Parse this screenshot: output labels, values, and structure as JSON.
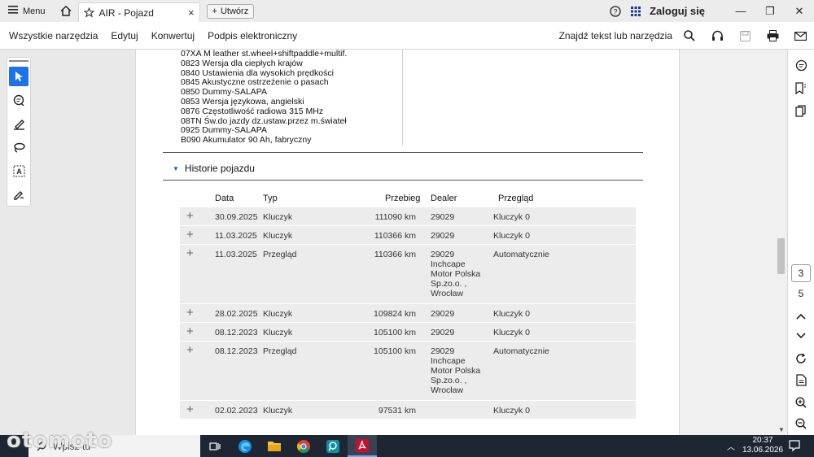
{
  "tabbar": {
    "menu_label": "Menu",
    "tab_title": "AIR - Pojazd",
    "tab_close": "×",
    "create_label": "Utwórz",
    "login_label": "Zaloguj się",
    "minimize": "—",
    "maximize": "❐",
    "close": "✕"
  },
  "menubar": {
    "items": [
      "Wszystkie narzędzia",
      "Edytuj",
      "Konwertuj",
      "Podpis elektroniczny"
    ],
    "find_label": "Znajdź tekst lub narzędzia"
  },
  "document": {
    "options": [
      "07XA M leather st.wheel+shiftpaddle+multif.",
      "0823 Wersja dla ciepłych krajów",
      "0840 Ustawienia dla wysokich prędkości",
      "0845 Akustyczne ostrzeżenie o pasach",
      "0850 Dummy-SALAPA",
      "0853 Wersja językowa, angielski",
      "0876 Częstotliwość radiowa 315 MHz",
      "08TN Św.do jazdy dz.ustaw.przez m.świateł",
      "0925 Dummy-SALAPA",
      "B090 Akumulator 90 Ah, fabryczny"
    ],
    "section_title": "Historie pojazdu",
    "headers": {
      "date": "Data",
      "type": "Typ",
      "mileage": "Przebieg",
      "dealer": "Dealer",
      "review": "Przegląd"
    },
    "rows": [
      {
        "date": "30.09.2025",
        "type": "Kluczyk",
        "mileage": "111090 km",
        "dealer": "29029",
        "review": "Kluczyk 0"
      },
      {
        "date": "11.03.2025",
        "type": "Kluczyk",
        "mileage": "110366 km",
        "dealer": "29029",
        "review": "Kluczyk 0"
      },
      {
        "date": "11.03.2025",
        "type": "Przegląd",
        "mileage": "110366 km",
        "dealer": "29029\nInchcape\nMotor Polska\nSp.zo.o. ,\nWrocław",
        "review": "Automatycznie"
      },
      {
        "date": "28.02.2025",
        "type": "Kluczyk",
        "mileage": "109824 km",
        "dealer": "29029",
        "review": "Kluczyk 0"
      },
      {
        "date": "08.12.2023",
        "type": "Kluczyk",
        "mileage": "105100 km",
        "dealer": "29029",
        "review": "Kluczyk 0"
      },
      {
        "date": "08.12.2023",
        "type": "Przegląd",
        "mileage": "105100 km",
        "dealer": "29029\nInchcape\nMotor Polska\nSp.zo.o. ,\nWrocław",
        "review": "Automatycznie"
      },
      {
        "date": "02.02.2023",
        "type": "Kluczyk",
        "mileage": "97531 km",
        "dealer": "",
        "review": "Kluczyk 0"
      }
    ]
  },
  "pager": {
    "current": "3",
    "total": "5"
  },
  "taskbar": {
    "search_placeholder": "Wpisz tu",
    "time": "20:37",
    "date": "13.06.2026"
  },
  "watermark": "otomoto",
  "colors": {
    "accent": "#1a73e8",
    "acrobat_red": "#c8102e",
    "taskbar": "#1f2633"
  },
  "icons": [
    "hamburger-icon",
    "home-icon",
    "star-icon",
    "plus-icon",
    "help-icon",
    "apps-grid-icon",
    "search-icon",
    "headphones-icon",
    "save-icon",
    "print-icon",
    "mail-icon",
    "select-arrow-icon",
    "comment-icon",
    "pen-icon",
    "lasso-icon",
    "text-select-icon",
    "sign-icon",
    "chat-icon",
    "bookmark-icon",
    "pages-icon",
    "chevron-up-icon",
    "chevron-down-icon",
    "refresh-icon",
    "doc-icon",
    "zoom-in-icon",
    "zoom-out-icon"
  ]
}
